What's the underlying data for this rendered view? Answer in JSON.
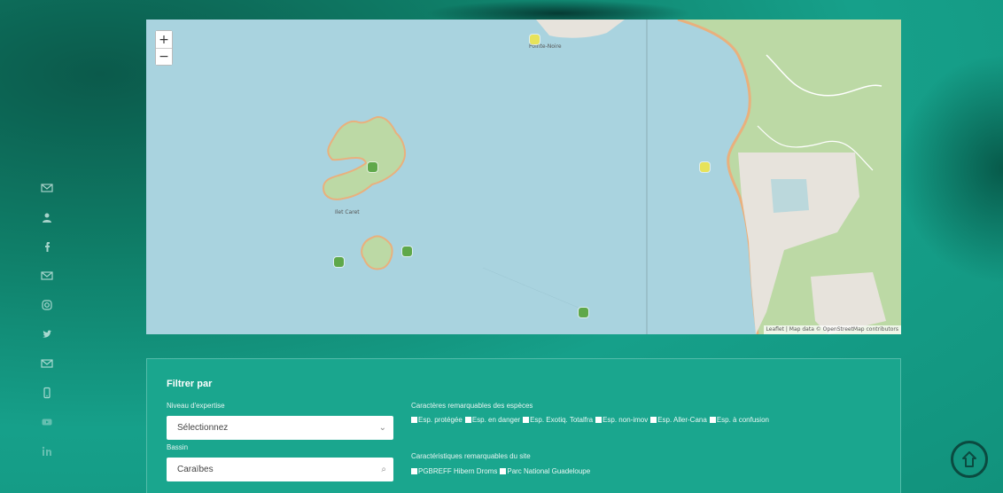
{
  "map": {
    "zoom_in": "+",
    "zoom_out": "−",
    "island_label": "Ilet Caret",
    "town_label": "Pointe-Noire",
    "attribution": "Leaflet | Map data © OpenStreetMap contributors",
    "markers": [
      {
        "color": "yellow"
      },
      {
        "color": "green"
      },
      {
        "color": "green"
      },
      {
        "color": "green"
      },
      {
        "color": "green"
      },
      {
        "color": "yellow"
      }
    ]
  },
  "side_icons": [
    "mail-icon",
    "user-icon",
    "facebook-icon",
    "mail-icon",
    "instagram-icon",
    "twitter-icon",
    "mail-icon",
    "phone-icon",
    "youtube-icon",
    "linkedin-icon"
  ],
  "filters": {
    "title": "Filtrer par",
    "level_label": "Niveau d'expertise",
    "level_value": "Sélectionnez",
    "basin_label": "Bassin",
    "basin_value": "Caraïbes",
    "species_label": "Caractères remarquables des espèces",
    "species_options": [
      "Esp. protégée",
      "Esp. en danger",
      "Esp. Exotiq. Totalfra",
      "Esp. non-imov",
      "Esp. Aller-Cana",
      "Esp. à confusion"
    ],
    "site_label": "Caractéristiques remarquables du site",
    "site_options": [
      "PGBREFF Hibern Droms",
      "Parc National Guadeloupe"
    ]
  },
  "colors": {
    "brand_teal": "#16a08a",
    "sea": "#a9d3df",
    "land": "#bcd9a5"
  }
}
